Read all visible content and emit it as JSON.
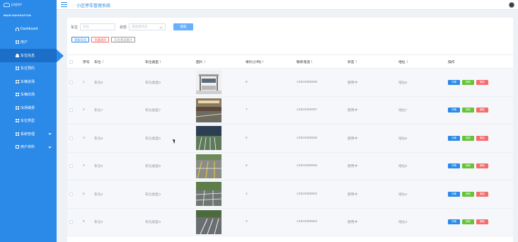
{
  "sidebar": {
    "logo_text": "paper",
    "section_title": "MAIN NAVIGATION",
    "items": [
      {
        "label": "Dashboard",
        "icon": "dashboard-icon"
      },
      {
        "label": "用户",
        "icon": "grid-icon"
      },
      {
        "label": "车位信息",
        "icon": "user-icon"
      },
      {
        "label": "车位预约",
        "icon": "grid-icon"
      },
      {
        "label": "车辆进场",
        "icon": "grid-icon"
      },
      {
        "label": "车辆出场",
        "icon": "grid-icon"
      },
      {
        "label": "出场缴费",
        "icon": "grid-icon"
      },
      {
        "label": "车位类型",
        "icon": "grid-icon"
      },
      {
        "label": "系统管理",
        "icon": "grid-icon"
      },
      {
        "label": "用户资料",
        "icon": "doc-icon"
      }
    ]
  },
  "header": {
    "title": "小区停车管理系统"
  },
  "filter": {
    "label_no": "车位",
    "placeholder_no": "车位",
    "label_status": "状态",
    "placeholder_status": "请选择状态",
    "search_label": "搜索"
  },
  "actions": {
    "add": "添加车位",
    "batch_delete": "批量删除",
    "stats": "车位状态统计"
  },
  "table": {
    "headers": {
      "idx": "序号",
      "no": "车位",
      "type": "车位类型",
      "image": "图片",
      "price": "单价(小时)",
      "phone": "联系电话",
      "status": "状态",
      "address": "地址",
      "op": "操作"
    },
    "op_labels": {
      "detail": "详情",
      "edit": "修改",
      "delete": "删除"
    },
    "rows": [
      {
        "idx": "1",
        "no": "车位8",
        "type": "车位类型8",
        "price": "8",
        "phone": "13823888888",
        "status": "使用中",
        "address": "地址8"
      },
      {
        "idx": "2",
        "no": "车位7",
        "type": "车位类型7",
        "price": "7",
        "phone": "13823888887",
        "status": "使用中",
        "address": "地址7"
      },
      {
        "idx": "3",
        "no": "车位6",
        "type": "车位类型6",
        "price": "6",
        "phone": "13823888886",
        "status": "使用中",
        "address": "地址6"
      },
      {
        "idx": "4",
        "no": "车位5",
        "type": "车位类型5",
        "price": "5",
        "phone": "13823888885",
        "status": "使用中",
        "address": "地址5"
      },
      {
        "idx": "5",
        "no": "车位4",
        "type": "车位类型4",
        "price": "4",
        "phone": "13823888884",
        "status": "使用中",
        "address": "地址4"
      },
      {
        "idx": "6",
        "no": "车位3",
        "type": "车位类型3",
        "price": "3",
        "phone": "13823888883",
        "status": "使用中",
        "address": "地址3"
      }
    ]
  },
  "colors": {
    "primary": "#2b89e8",
    "success": "#67c23a",
    "danger": "#f56c6c"
  }
}
